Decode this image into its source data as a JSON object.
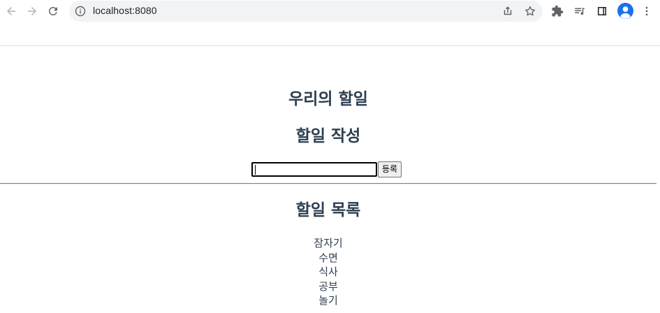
{
  "browser": {
    "url": "localhost:8080"
  },
  "page": {
    "title": "우리의 할일",
    "form_heading": "할일 작성",
    "input_value": "",
    "submit_label": "등록",
    "list_heading": "할일 목록",
    "todos": [
      "잠자기",
      "수면",
      "식사",
      "공부",
      "놀기"
    ]
  },
  "colors": {
    "text": "#2c3e50",
    "omnibox_bg": "#f1f3f4",
    "avatar": "#1a73e8"
  }
}
